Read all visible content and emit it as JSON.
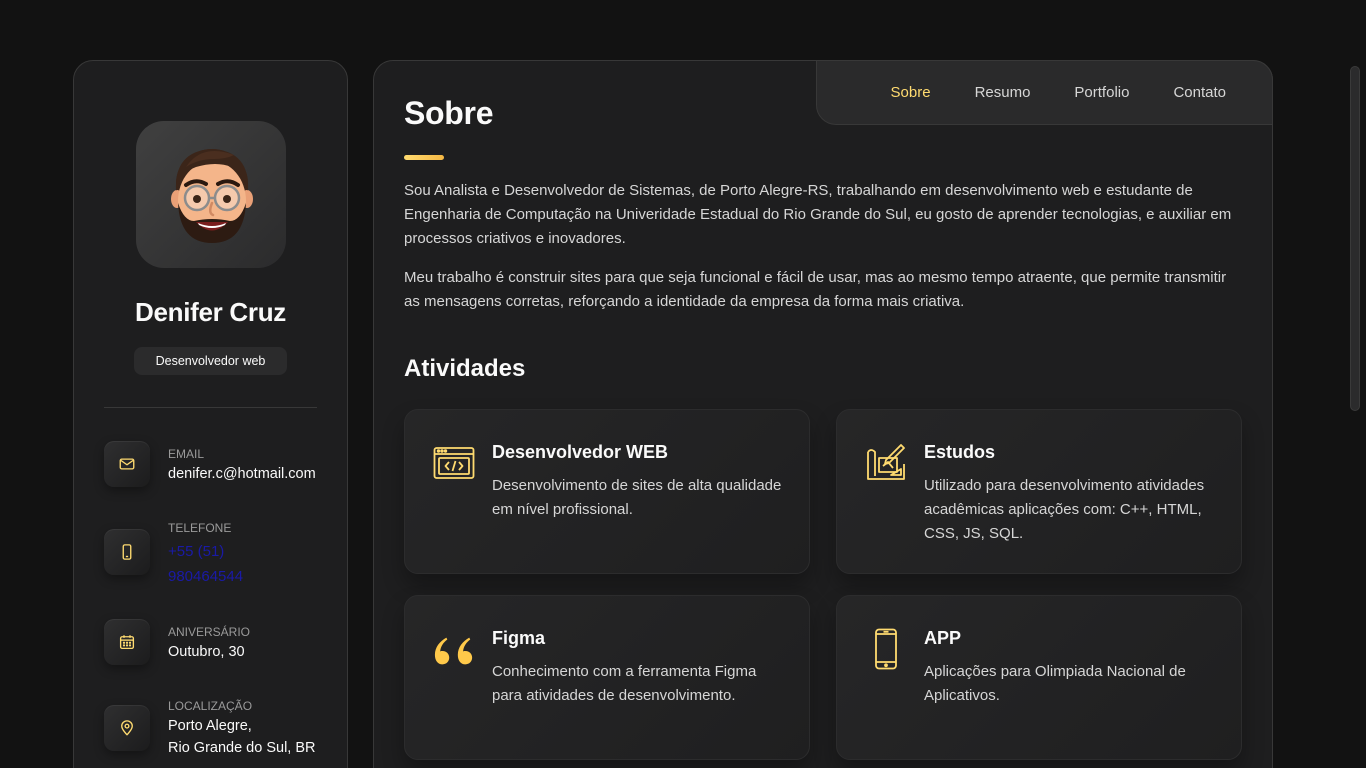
{
  "profile": {
    "name": "Denifer Cruz",
    "title": "Desenvolvedor web"
  },
  "contacts": [
    {
      "label": "EMAIL",
      "value": "denifer.c@hotmail.com",
      "icon": "mail-icon"
    },
    {
      "label": "TELEFONE",
      "value": "+55 (51) 980464544",
      "icon": "smartphone-icon"
    },
    {
      "label": "ANIVERSÁRIO",
      "value": "Outubro, 30",
      "icon": "calendar-icon"
    },
    {
      "label": "LOCALIZAÇÃO",
      "value_line1": "Porto Alegre,",
      "value_line2": "Rio Grande do Sul, BR",
      "icon": "location-pin-icon"
    }
  ],
  "nav": {
    "items": [
      "Sobre",
      "Resumo",
      "Portfolio",
      "Contato"
    ],
    "active": "Sobre"
  },
  "about": {
    "title": "Sobre",
    "paragraph1": "Sou Analista e Desenvolvedor de Sistemas, de Porto Alegre-RS, trabalhando em desenvolvimento web e estudante de Engenharia de Computação na Univeridade Estadual do Rio Grande do Sul, eu gosto de aprender tecnologias, e auxiliar em processos criativos e inovadores.",
    "paragraph2": "Meu trabalho é construir sites para que seja funcional e fácil de usar, mas ao mesmo tempo atraente, que permite transmitir as mensagens corretas, reforçando a identidade da empresa da forma mais criativa."
  },
  "activities": {
    "title": "Atividades",
    "items": [
      {
        "title": "Desenvolvedor WEB",
        "text": "Desenvolvimento de sites de alta qualidade em nível profissional.",
        "icon": "code-window-icon"
      },
      {
        "title": "Estudos",
        "text": "Utilizado para desenvolvimento atividades acadêmicas aplicações com: C++, HTML, CSS, JS, SQL.",
        "icon": "design-tools-icon"
      },
      {
        "title": "Figma",
        "text": "Conhecimento com a ferramenta Figma para atividades de desenvolvimento.",
        "icon": "quote-icon"
      },
      {
        "title": "APP",
        "text": "Aplicações para Olimpiada Nacional de Aplicativos.",
        "icon": "smartphone-icon"
      }
    ]
  },
  "colors": {
    "accent": "#ffdb70",
    "background": "#121212",
    "panel": "#1e1e1f"
  }
}
